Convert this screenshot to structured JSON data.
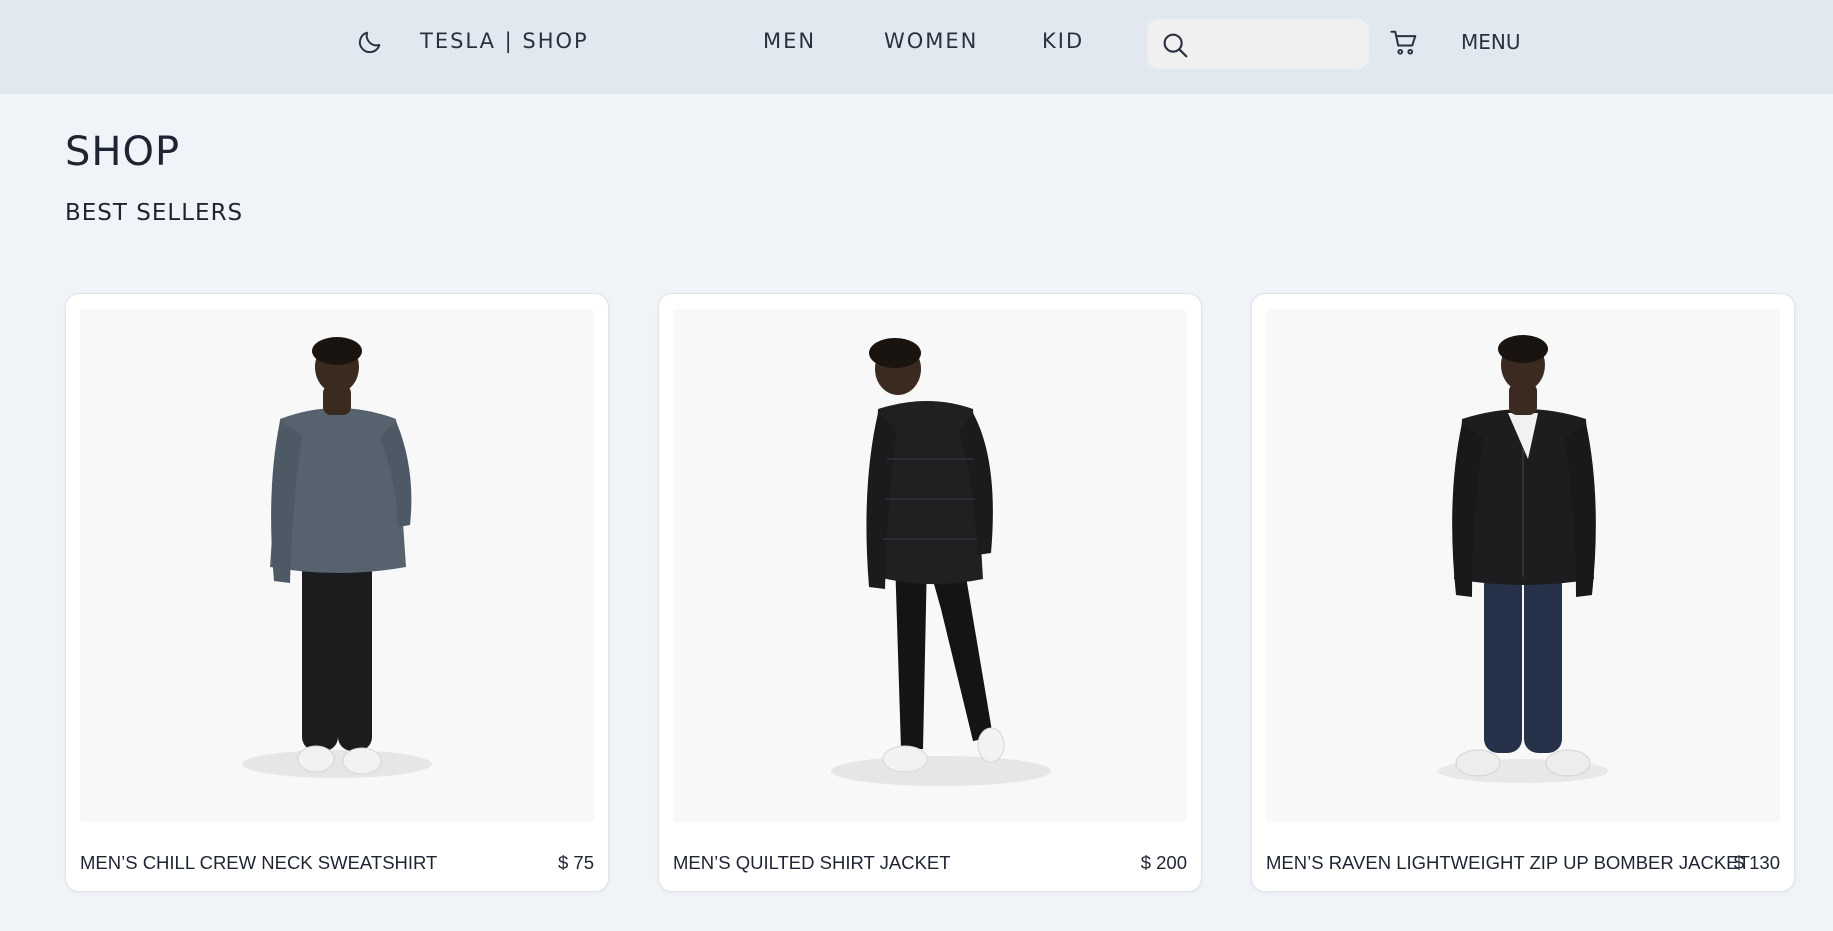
{
  "header": {
    "brand": "TESLA | SHOP",
    "nav": [
      "MEN",
      "WOMEN",
      "KID"
    ],
    "search_placeholder": "",
    "menu_label": "MENU",
    "icons": {
      "theme": "moon-icon",
      "search": "search-icon",
      "cart": "cart-icon"
    }
  },
  "page": {
    "title": "SHOP",
    "section": "BEST SELLERS"
  },
  "products": [
    {
      "name": "MEN’S CHILL CREW NECK SWEATSHIRT",
      "price": "$ 75",
      "top_color": "#56636f",
      "bottom_color": "#1c1c1e"
    },
    {
      "name": "MEN’S QUILTED SHIRT JACKET",
      "price": "$ 200",
      "top_color": "#1f2022",
      "bottom_color": "#141416"
    },
    {
      "name": "MEN’S RAVEN LIGHTWEIGHT ZIP UP BOMBER JACKET",
      "price": "$ 130",
      "top_color": "#1d1d1f",
      "bottom_color": "#26324a"
    }
  ],
  "colors": {
    "header_bg": "#e2e8f0",
    "page_bg": "#f0f3f8",
    "card_bg": "#ffffff",
    "photo_bg": "#f8f8f8",
    "text": "#1f2433"
  }
}
